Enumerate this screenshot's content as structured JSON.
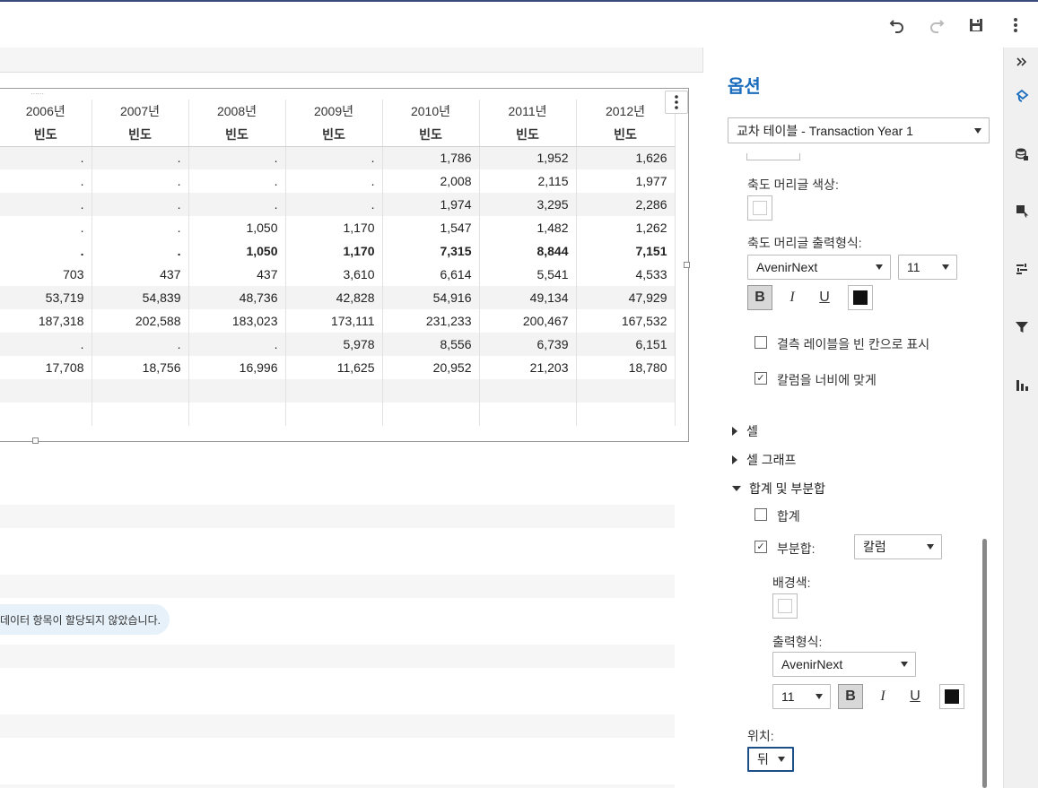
{
  "toolbar": {
    "icons": [
      "undo-icon",
      "redo-icon",
      "save-icon",
      "more-vertical-icon"
    ]
  },
  "crosstab": {
    "years": [
      "2006년",
      "2007년",
      "2008년",
      "2009년",
      "2010년",
      "2011년",
      "2012년"
    ],
    "measure_label": "빈도",
    "rows": [
      {
        "values": [
          ".",
          ".",
          ".",
          ".",
          "1,786",
          "1,952",
          "1,626"
        ]
      },
      {
        "values": [
          ".",
          ".",
          ".",
          ".",
          "2,008",
          "2,115",
          "1,977"
        ]
      },
      {
        "values": [
          ".",
          ".",
          ".",
          ".",
          "1,974",
          "3,295",
          "2,286"
        ]
      },
      {
        "values": [
          ".",
          ".",
          "1,050",
          "1,170",
          "1,547",
          "1,482",
          "1,262"
        ]
      },
      {
        "values": [
          ".",
          ".",
          "1,050",
          "1,170",
          "7,315",
          "8,844",
          "7,151"
        ]
      },
      {
        "values": [
          "703",
          "437",
          "437",
          "3,610",
          "6,614",
          "5,541",
          "4,533"
        ]
      },
      {
        "values": [
          "53,719",
          "54,839",
          "48,736",
          "42,828",
          "54,916",
          "49,134",
          "47,929"
        ]
      },
      {
        "values": [
          "187,318",
          "202,588",
          "183,023",
          "173,111",
          "231,233",
          "200,467",
          "167,532"
        ]
      },
      {
        "values": [
          ".",
          ".",
          ".",
          "5,978",
          "8,556",
          "6,739",
          "6,151"
        ]
      },
      {
        "values": [
          "17,708",
          "18,756",
          "16,996",
          "11,625",
          "20,952",
          "21,203",
          "18,780"
        ]
      },
      {
        "values": [
          "",
          "",
          "",
          "",
          "",
          "",
          ""
        ]
      },
      {
        "values": [
          "",
          "",
          "",
          "",
          "",
          "",
          ""
        ]
      }
    ]
  },
  "info_message": "데이터 항목이 할당되지 않았습니다.",
  "panel": {
    "title": "옵션",
    "object_select": "교차 테이블 - Transaction Year 1",
    "header_color_label": "축도 머리글 색상:",
    "header_format_label": "축도 머리글 출력형식:",
    "header_font": "AvenirNext",
    "header_size": "11",
    "bold": "B",
    "italic": "I",
    "underline": "U",
    "missing_blank_label": "결측 레이블을 빈 칸으로 표시",
    "missing_blank_checked": false,
    "fit_columns_label": "칼럼을 너비에 맞게",
    "fit_columns_checked": true,
    "section_cell": "셀",
    "section_cell_graph": "셀 그래프",
    "section_totals": "합계 및 부분합",
    "total_label": "합계",
    "total_checked": false,
    "subtotal_label": "부분합:",
    "subtotal_checked": true,
    "subtotal_select": "칼럼",
    "bgcolor_label": "배경색:",
    "format_label": "출력형식:",
    "format_font": "AvenirNext",
    "format_size": "11",
    "position_label": "위치:",
    "position_select": "뒤"
  },
  "rail": {
    "icons": [
      "collapse-panel-icon",
      "paint-options-icon",
      "data-icon",
      "object-icon",
      "rules-icon",
      "filter-icon",
      "chart-icon"
    ]
  },
  "colors": {
    "accent": "#1a6dbd",
    "topbar_border": "#3a4a7a",
    "info_bg": "#e6f1fa"
  }
}
